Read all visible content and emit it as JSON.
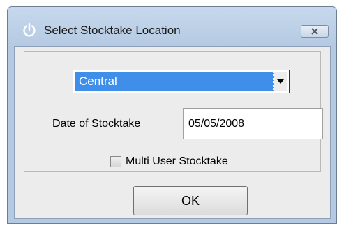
{
  "window": {
    "title": "Select Stocktake Location",
    "icon": "power-icon",
    "close_icon": "close-icon"
  },
  "location": {
    "selected": "Central"
  },
  "date": {
    "label": "Date of Stocktake",
    "value": "05/05/2008"
  },
  "multi_user": {
    "label": "Multi User Stocktake",
    "checked": false
  },
  "ok_button": {
    "label": "OK"
  },
  "colors": {
    "selection": "#3f8fea",
    "titlebar": "#c6d8ec",
    "dialog_bg": "#ececec"
  }
}
